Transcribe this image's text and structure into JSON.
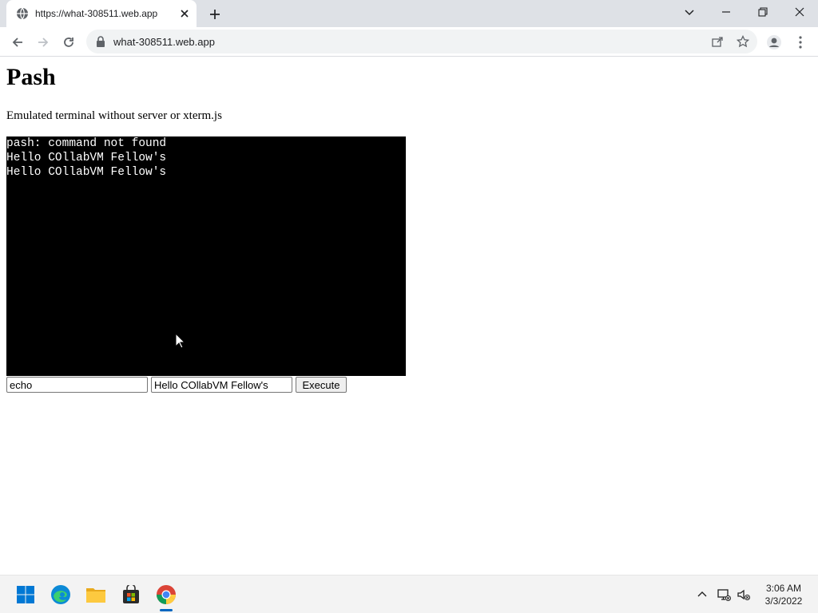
{
  "browser": {
    "tab_title": "https://what-308511.web.app",
    "url": "what-308511.web.app"
  },
  "page": {
    "title": "Pash",
    "subtitle": "Emulated terminal without server or xterm.js",
    "terminal_lines": [
      "pash: command not found",
      "Hello COllabVM Fellow's",
      "Hello COllabVM Fellow's"
    ],
    "command_value": "echo",
    "argument_value": "Hello COllabVM Fellow's",
    "execute_label": "Execute"
  },
  "taskbar": {
    "apps": [
      "start-icon",
      "edge-icon",
      "file-explorer-icon",
      "store-icon",
      "chrome-icon"
    ],
    "time": "3:06 AM",
    "date": "3/3/2022"
  }
}
